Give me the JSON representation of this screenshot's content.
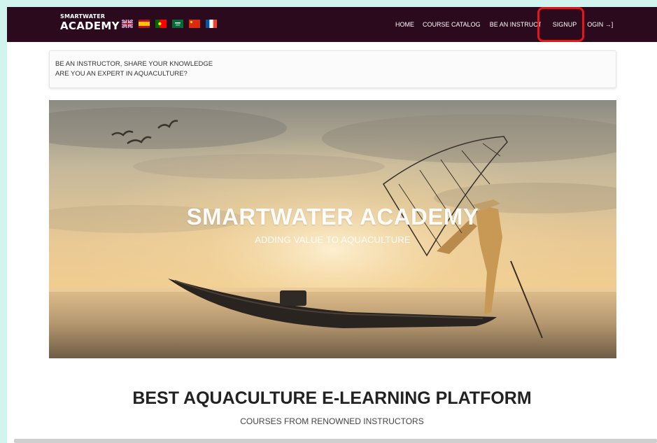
{
  "navbar": {
    "logo_line1": "SMARTWATER",
    "logo_line2": "ACADEMY",
    "flags": [
      "uk-flag-icon",
      "spain-flag-icon",
      "portugal-flag-icon",
      "saudi-flag-icon",
      "china-flag-icon",
      "france-flag-icon"
    ],
    "links": {
      "home": "HOME",
      "catalog": "COURSE CATALOG",
      "instructor": "BE AN INSTRUCTOR",
      "signup": "SIGNUP",
      "login": "LOGIN →]"
    },
    "highlight_color": "#e8141b",
    "bg_color": "#2a0a1c"
  },
  "info": {
    "line1": "BE AN INSTRUCTOR, SHARE YOUR KNOWLEDGE",
    "line2": "ARE YOU AN EXPERT IN AQUACULTURE?"
  },
  "hero": {
    "title": "SMARTWATER ACADEMY",
    "subtitle": "ADDING VALUE TO AQUACULTURE"
  },
  "section": {
    "title": "BEST AQUACULTURE E-LEARNING PLATFORM",
    "subtitle": "COURSES FROM RENOWNED INSTRUCTORS"
  }
}
